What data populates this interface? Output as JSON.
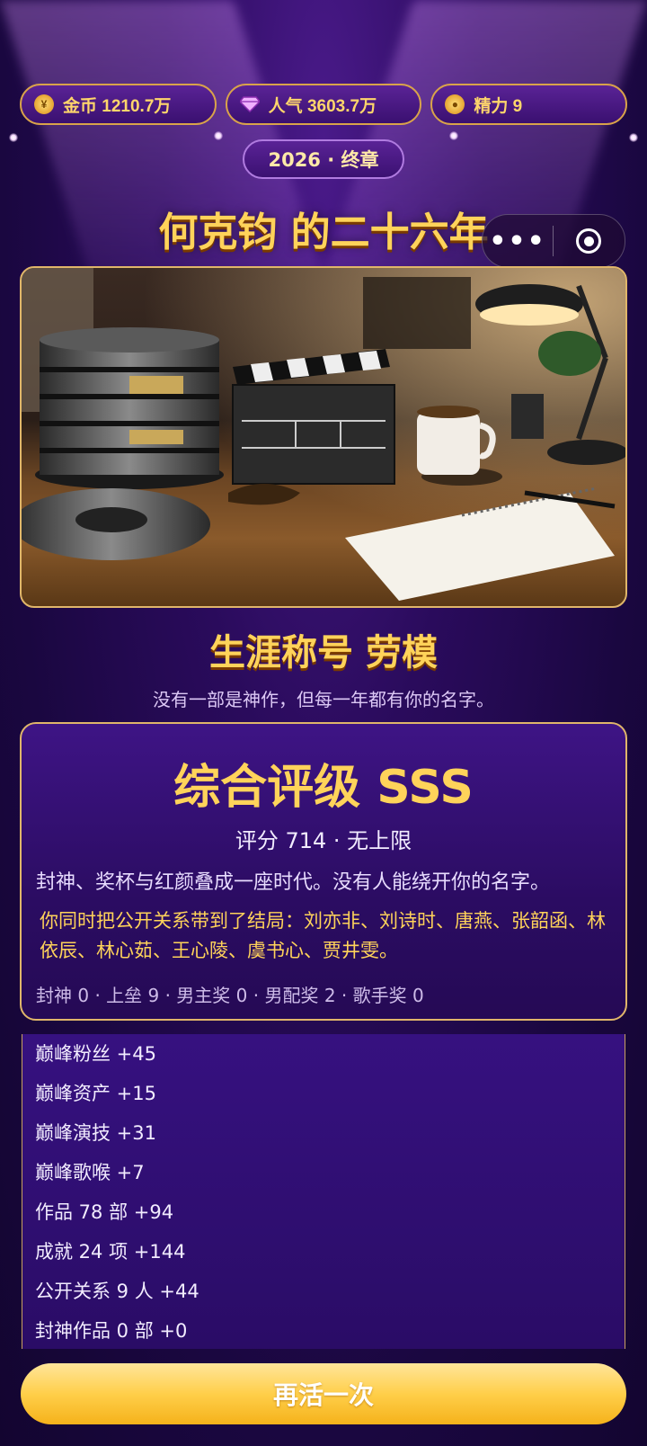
{
  "stats": {
    "coins": "金币 1210.7万",
    "popularity": "人气 3603.7万",
    "energy": "精力 9"
  },
  "year_badge": "2026 · 终章",
  "title": "何克钧 的二十六年",
  "career": {
    "title": "生涯称号 劳模",
    "motto": "没有一部是神作，但每一年都有你的名字。"
  },
  "rating": {
    "grade": "综合评级 SSS",
    "score_line": "评分 714 · 无上限",
    "description": "封神、奖杯与红颜叠成一座时代。没有人能绕开你的名字。",
    "relationships": "你同时把公开关系带到了结局：刘亦非、刘诗时、唐燕、张韶函、林依辰、林心茹、王心陵、虞书心、贾井雯。",
    "counts": "封神 0 · 上垒 9 · 男主奖 0 · 男配奖 2 · 歌手奖 0"
  },
  "breakdown": [
    "巅峰粉丝 +45",
    "巅峰资产 +15",
    "巅峰演技 +31",
    "巅峰歌喉 +7",
    "作品 78 部 +94",
    "成就 24 项 +144",
    "公开关系 9 人 +44",
    "封神作品 0 部 +0"
  ],
  "replay_button": "再活一次",
  "colors": {
    "gold": "#ffd35a",
    "purple_bg": "#2a0b5c",
    "border_gold": "#e0b66a"
  },
  "icons": [
    "coin-icon",
    "gem-icon",
    "energy-coin-icon",
    "more-dots-icon",
    "record-icon"
  ]
}
